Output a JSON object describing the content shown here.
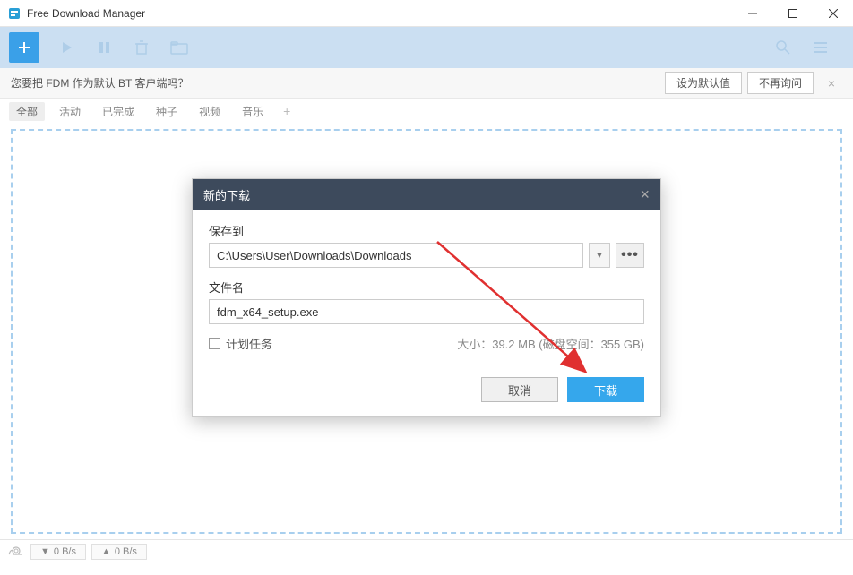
{
  "window": {
    "title": "Free Download Manager"
  },
  "notice": {
    "text": "您要把 FDM 作为默认 BT 客户端吗？",
    "set_default": "设为默认值",
    "dont_ask": "不再询问"
  },
  "filters": {
    "items": [
      {
        "label": "全部",
        "active": true
      },
      {
        "label": "活动",
        "active": false
      },
      {
        "label": "已完成",
        "active": false
      },
      {
        "label": "种子",
        "active": false
      },
      {
        "label": "视频",
        "active": false
      },
      {
        "label": "音乐",
        "active": false
      }
    ]
  },
  "status": {
    "down_speed": "0 B/s",
    "up_speed": "0 B/s"
  },
  "dialog": {
    "title": "新的下载",
    "save_to_label": "保存到",
    "save_to_value": "C:\\Users\\User\\Downloads\\Downloads",
    "filename_label": "文件名",
    "filename_value": "fdm_x64_setup.exe",
    "schedule_label": "计划任务",
    "size_info": "大小：39.2 MB (磁盘空间：355 GB)",
    "cancel": "取消",
    "download": "下载",
    "browse": "•••"
  }
}
